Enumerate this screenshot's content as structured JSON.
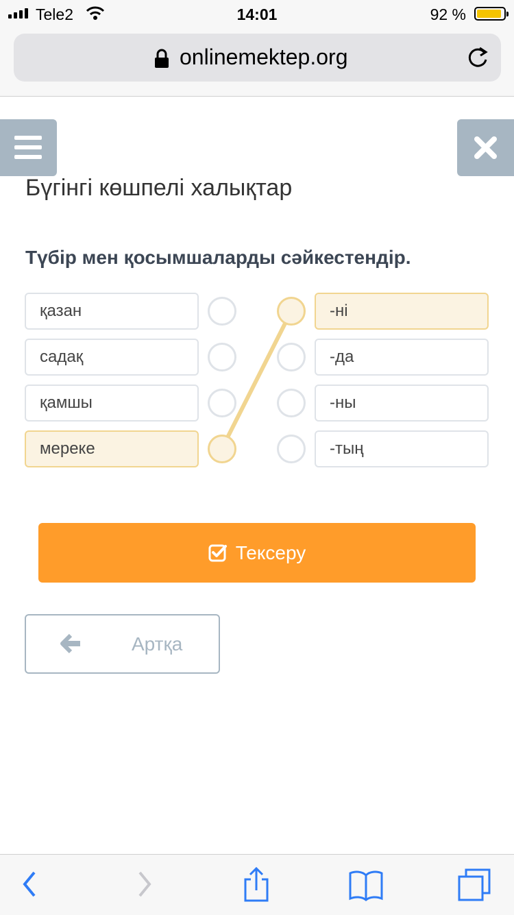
{
  "status_bar": {
    "carrier": "Tele2",
    "time": "14:01",
    "battery_percent": "92 %",
    "battery_level": 0.92
  },
  "browser": {
    "url": "onlinemektep.org"
  },
  "lesson": {
    "title": "Бүгінгі көшпелі халықтар",
    "instruction": "Түбір мен қосымшаларды сәйкестендір."
  },
  "match": {
    "left": [
      "қазан",
      "садақ",
      "қамшы",
      "мереке"
    ],
    "right": [
      "-ні",
      "-да",
      "-ны",
      "-тың"
    ],
    "connection": {
      "left_item": "мереке",
      "right_item": "-ні"
    }
  },
  "buttons": {
    "check": "Тексеру",
    "back": "Артқа"
  },
  "colors": {
    "accent": "#ff9c2a",
    "tab": "#a7b6c2",
    "selected_fill": "#fbf3e2",
    "selected_border": "#f1d590"
  },
  "icons": [
    "signal-icon",
    "wifi-icon",
    "battery-icon",
    "lock-icon",
    "reload-icon",
    "menu-icon",
    "close-icon",
    "checkbox-icon",
    "arrow-left-icon",
    "back-chevron-icon",
    "forward-chevron-icon",
    "share-icon",
    "bookmarks-icon",
    "tabs-icon"
  ]
}
